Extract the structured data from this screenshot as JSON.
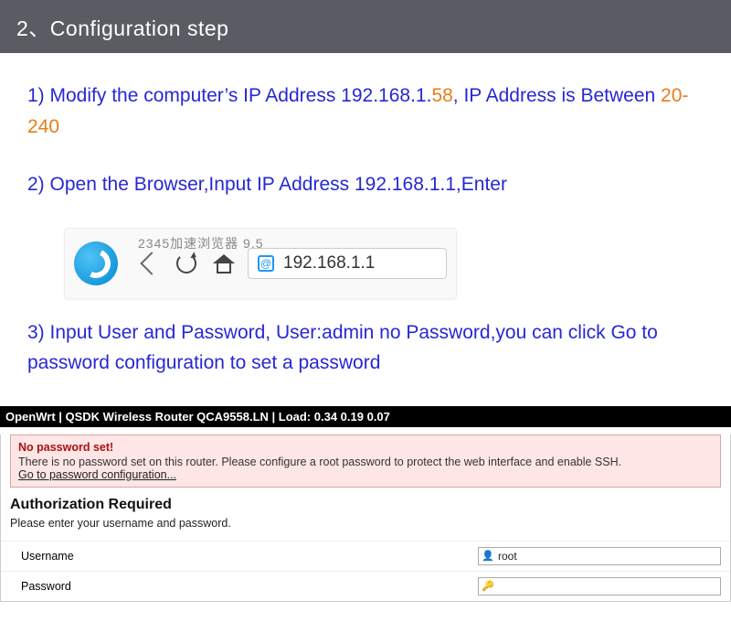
{
  "header": {
    "title": "2、Configuration step"
  },
  "step1": {
    "pre": "1) Modify the computer’s IP Address 192.168.1.",
    "hl1": "58",
    "mid": ", IP Address is Between ",
    "hl2": "20-240"
  },
  "step2": {
    "text": "2) Open the Browser,Input IP Address 192.168.1.1,Enter"
  },
  "browser": {
    "title": "2345加速浏览器 9.5",
    "addr": "192.168.1.1",
    "addr_icon": "@"
  },
  "step3": {
    "text": "3) Input User and Password, User:admin  no Password,you can click Go to password configuration to set a password"
  },
  "router": {
    "bar": "OpenWrt | QSDK Wireless Router QCA9558.LN | Load: 0.34 0.19 0.07",
    "warn_title": "No password set!",
    "warn_text": "There is no password set on this router. Please configure a root password to protect the web interface and enable SSH.",
    "warn_link": "Go to password configuration...",
    "auth_title": "Authorization Required",
    "auth_sub": "Please enter your username and password.",
    "user_label": "Username",
    "user_value": "root",
    "pass_label": "Password",
    "pass_value": ""
  }
}
